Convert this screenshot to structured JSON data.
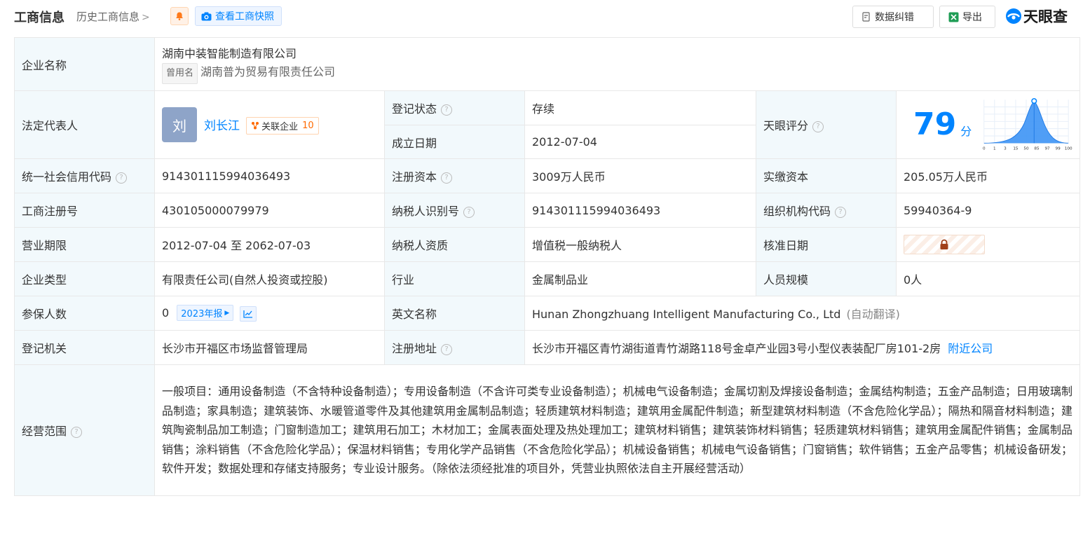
{
  "header": {
    "title": "工商信息",
    "history_link": "历史工商信息",
    "snapshot_button": "查看工商快照",
    "data_error_button": "数据纠错",
    "export_button": "导出",
    "logo_text": "天眼查",
    "accent_color": "#0084ff"
  },
  "company": {
    "name_label": "企业名称",
    "name": "湖南中装智能制造有限公司",
    "former_name_tag": "曾用名",
    "former_name": "湖南普为贸易有限责任公司",
    "legal_rep_label": "法定代表人",
    "legal_rep_avatar": "刘",
    "legal_rep": "刘长江",
    "related_label": "关联企业",
    "related_count": "10",
    "reg_status_label": "登记状态",
    "reg_status": "存续",
    "found_date_label": "成立日期",
    "found_date": "2012-07-04",
    "score_label": "天眼评分",
    "score": "79",
    "score_unit": "分",
    "score_axis": [
      "0",
      "1",
      "3",
      "15",
      "50",
      "85",
      "97",
      "99",
      "100"
    ],
    "credit_code_label": "统一社会信用代码",
    "credit_code": "914301115994036493",
    "reg_capital_label": "注册资本",
    "reg_capital": "3009万人民币",
    "paid_capital_label": "实缴资本",
    "paid_capital": "205.05万人民币",
    "reg_no_label": "工商注册号",
    "reg_no": "430105000079979",
    "taxpayer_id_label": "纳税人识别号",
    "taxpayer_id": "914301115994036493",
    "org_code_label": "组织机构代码",
    "org_code": "59940364-9",
    "term_label": "营业期限",
    "term": "2012-07-04 至 2062-07-03",
    "taxpayer_qual_label": "纳税人资质",
    "taxpayer_qual": "增值税一般纳税人",
    "approve_date_label": "核准日期",
    "type_label": "企业类型",
    "type": "有限责任公司(自然人投资或控股)",
    "industry_label": "行业",
    "industry": "金属制品业",
    "staff_label": "人员规模",
    "staff": "0人",
    "insured_label": "参保人数",
    "insured": "0",
    "insured_year": "2023年报",
    "en_name_label": "英文名称",
    "en_name": "Hunan Zhongzhuang Intelligent Manufacturing Co., Ltd",
    "en_name_note": "(自动翻译)",
    "authority_label": "登记机关",
    "authority": "长沙市开福区市场监督管理局",
    "address_label": "注册地址",
    "address": "长沙市开福区青竹湖街道青竹湖路118号金卓产业园3号小型仪表装配厂房101-2房",
    "nearby_link": "附近公司",
    "scope_label": "经营范围",
    "scope": "一般项目：通用设备制造（不含特种设备制造）；专用设备制造（不含许可类专业设备制造）；机械电气设备制造；金属切割及焊接设备制造；金属结构制造；五金产品制造；日用玻璃制品制造；家具制造；建筑装饰、水暖管道零件及其他建筑用金属制品制造；轻质建筑材料制造；建筑用金属配件制造；新型建筑材料制造（不含危险化学品）；隔热和隔音材料制造；建筑陶瓷制品加工制造；门窗制造加工；建筑用石加工；木材加工；金属表面处理及热处理加工；建筑材料销售；建筑装饰材料销售；轻质建筑材料销售；建筑用金属配件销售；金属制品销售；涂料销售（不含危险化学品）；保温材料销售；专用化学产品销售（不含危险化学品）；机械设备销售；机械电气设备销售；门窗销售；软件销售；五金产品零售；机械设备研发；软件开发；数据处理和存储支持服务；专业设计服务。（除依法须经批准的项目外，凭营业执照依法自主开展经营活动）"
  }
}
